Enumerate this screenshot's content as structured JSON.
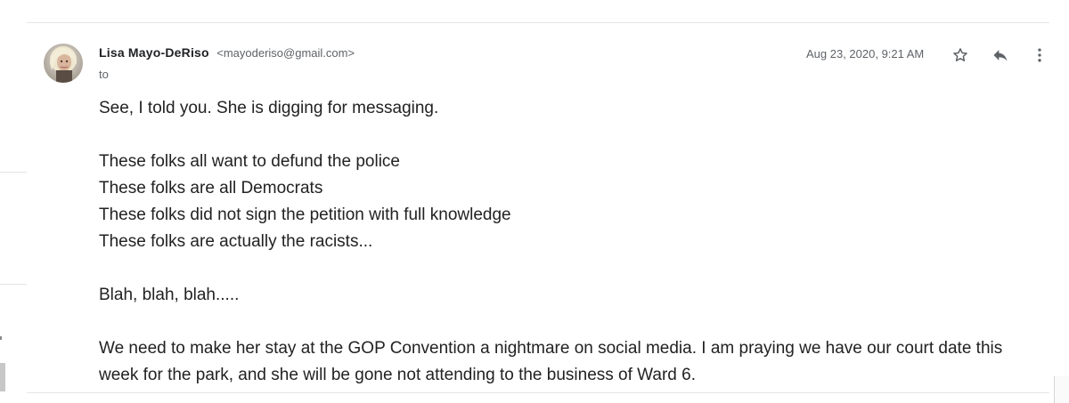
{
  "message": {
    "sender_name": "Lisa Mayo-DeRiso",
    "sender_email": "<mayoderiso@gmail.com>",
    "to_label": "to",
    "timestamp": "Aug 23, 2020, 9:21 AM"
  },
  "icons": {
    "star": "star-outline-icon",
    "reply": "reply-icon",
    "more": "more-vertical-icon"
  },
  "body": {
    "line1": "See, I told you. She is digging for messaging.",
    "line2": "These folks all want to defund the police",
    "line3": "These folks are all Democrats",
    "line4": "These folks did not sign the petition with full knowledge",
    "line5": "These folks are actually the racists...",
    "line6": "Blah, blah, blah.....",
    "line7": "We need to make her stay at the GOP Convention a nightmare on social media. I am praying we have our court date this week for the park, and she will be gone not attending to the business of Ward 6."
  },
  "colors": {
    "text": "#222222",
    "secondary_text": "#5f6368",
    "icon": "#5f6368"
  }
}
